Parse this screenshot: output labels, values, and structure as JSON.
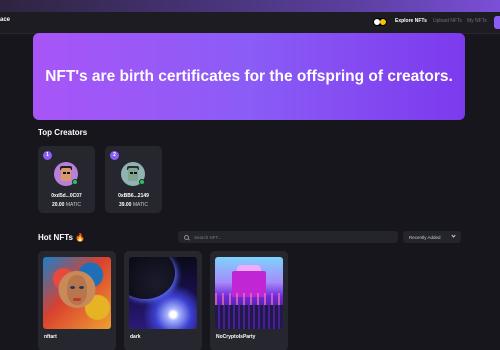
{
  "nav": {
    "brand": "ace",
    "links": [
      "Explore NFTs",
      "Upload NFTs",
      "My NFTs"
    ]
  },
  "hero": {
    "text": "NFT's are birth certificates for the offspring of creators."
  },
  "top_creators": {
    "title": "Top Creators",
    "items": [
      {
        "rank": "1",
        "address": "0xd5d...0C07",
        "amount": "20.00",
        "currency": "MATIC"
      },
      {
        "rank": "2",
        "address": "0xBB6...2149",
        "amount": "39.00",
        "currency": "MATIC"
      }
    ]
  },
  "hot_nfts": {
    "title": "Hot NFTs 🔥",
    "search_placeholder": "Search NFT...",
    "sort_value": "Recently Added",
    "items": [
      {
        "name": "nftart"
      },
      {
        "name": "dark"
      },
      {
        "name": "NoCryptoIsParty"
      }
    ]
  },
  "colors": {
    "accent": "#8b5cf6",
    "background": "#16161c",
    "card": "#26262f"
  }
}
